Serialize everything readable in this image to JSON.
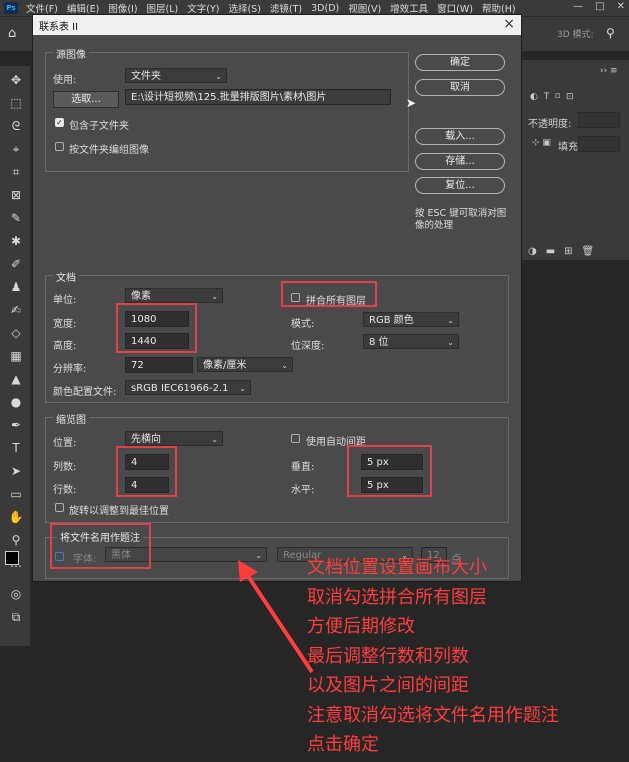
{
  "menubar": {
    "logo": "Ps",
    "items": [
      "文件(F)",
      "编辑(E)",
      "图像(I)",
      "图层(L)",
      "文字(Y)",
      "选择(S)",
      "滤镜(T)",
      "3D(D)",
      "视图(V)",
      "增效工具",
      "窗口(W)",
      "帮助(H)"
    ],
    "window_controls": [
      "—",
      "□",
      "✕"
    ]
  },
  "options_bar": {
    "mode3d": "3D 模式:"
  },
  "right_panel": {
    "opacity_label": "不透明度:",
    "fill_label": "填充:"
  },
  "dialog": {
    "title": "联系表 II",
    "source": {
      "group_title": "源图像",
      "use_label": "使用:",
      "use_value": "文件夹",
      "browse_button": "选取...",
      "path": "E:\\设计短视频\\125.批量排版图片\\素材\\图片",
      "include_subfolders": "包含子文件夹",
      "group_by_folder": "按文件夹编组图像"
    },
    "buttons": {
      "ok": "确定",
      "cancel": "取消",
      "load": "载入...",
      "save": "存储...",
      "reset": "复位..."
    },
    "hint": "按 ESC 键可取消对图像的处理",
    "document": {
      "group_title": "文档",
      "units_label": "单位:",
      "units_value": "像素",
      "width_label": "宽度:",
      "width_value": "1080",
      "height_label": "高度:",
      "height_value": "1440",
      "resolution_label": "分辨率:",
      "resolution_value": "72",
      "resolution_unit": "像素/厘米",
      "profile_label": "颜色配置文件:",
      "profile_value": "sRGB IEC61966-2.1",
      "flatten_label": "拼合所有图层",
      "mode_label": "模式:",
      "mode_value": "RGB 颜色",
      "depth_label": "位深度:",
      "depth_value": "8 位"
    },
    "thumbnails": {
      "group_title": "缩览图",
      "place_label": "位置:",
      "place_value": "先横向",
      "columns_label": "列数:",
      "columns_value": "4",
      "rows_label": "行数:",
      "rows_value": "4",
      "rotate_label": "旋转以调整到最佳位置",
      "auto_spacing_label": "使用自动间距",
      "vertical_label": "垂直:",
      "vertical_value": "5 px",
      "horizontal_label": "水平:",
      "horizontal_value": "5 px"
    },
    "caption": {
      "group_title": "将文件名用作题注",
      "font_label": "字体:",
      "font_value": "黑体",
      "style_value": "Regular",
      "size_value": "12",
      "size_unit": "点"
    }
  },
  "annotation": {
    "lines": [
      "文档位置设置画布大小",
      "取消勾选拼合所有图层",
      "方便后期修改",
      "最后调整行数和列数",
      "以及图片之间的间距",
      "注意取消勾选将文件名用作题注",
      "点击确定"
    ],
    "color": "#ff3d3d",
    "box_color": "#e0414a"
  }
}
